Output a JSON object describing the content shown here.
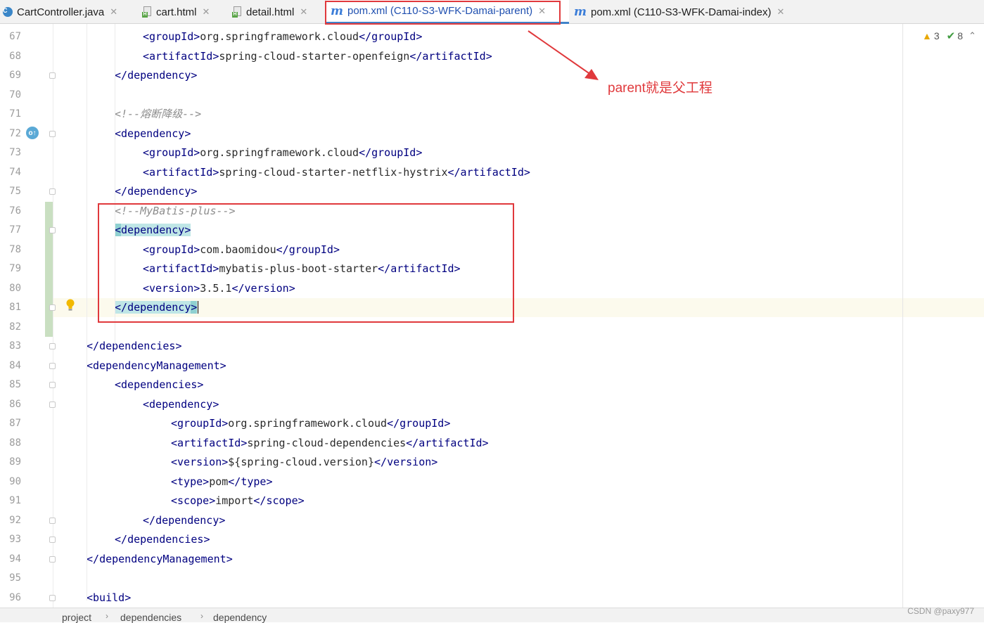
{
  "tabs": [
    {
      "label": "CartController.java",
      "icon": "java-class-icon",
      "active": false
    },
    {
      "label": "cart.html",
      "icon": "html-file-icon",
      "active": false
    },
    {
      "label": "detail.html",
      "icon": "html-file-icon",
      "active": false
    },
    {
      "label": "pom.xml (C110-S3-WFK-Damai-parent)",
      "icon": "maven-icon",
      "active": true
    },
    {
      "label": "pom.xml (C110-S3-WFK-Damai-index)",
      "icon": "maven-icon",
      "active": false
    }
  ],
  "editor": {
    "lines": [
      {
        "num": "67",
        "indent": 3,
        "tokens": [
          [
            "b",
            "<"
          ],
          [
            "b",
            "groupId"
          ],
          [
            "b",
            ">"
          ],
          [
            "k",
            "org.springframework.cloud"
          ],
          [
            "b",
            "</"
          ],
          [
            "b",
            "groupId"
          ],
          [
            "b",
            ">"
          ]
        ]
      },
      {
        "num": "68",
        "indent": 3,
        "tokens": [
          [
            "b",
            "<"
          ],
          [
            "b",
            "artifactId"
          ],
          [
            "b",
            ">"
          ],
          [
            "k",
            "spring-cloud-starter-openfeign"
          ],
          [
            "b",
            "</"
          ],
          [
            "b",
            "artifactId"
          ],
          [
            "b",
            ">"
          ]
        ]
      },
      {
        "num": "69",
        "indent": 2,
        "tokens": [
          [
            "b",
            "</"
          ],
          [
            "b",
            "dependency"
          ],
          [
            "b",
            ">"
          ]
        ]
      },
      {
        "num": "70",
        "indent": 0,
        "tokens": []
      },
      {
        "num": "71",
        "indent": 2,
        "tokens": [
          [
            "cm",
            "<!--熔断降级-->"
          ]
        ]
      },
      {
        "num": "72",
        "indent": 2,
        "tokens": [
          [
            "b",
            "<"
          ],
          [
            "b",
            "dependency"
          ],
          [
            "b",
            ">"
          ]
        ]
      },
      {
        "num": "73",
        "indent": 3,
        "tokens": [
          [
            "b",
            "<"
          ],
          [
            "b",
            "groupId"
          ],
          [
            "b",
            ">"
          ],
          [
            "k",
            "org.springframework.cloud"
          ],
          [
            "b",
            "</"
          ],
          [
            "b",
            "groupId"
          ],
          [
            "b",
            ">"
          ]
        ]
      },
      {
        "num": "74",
        "indent": 3,
        "tokens": [
          [
            "b",
            "<"
          ],
          [
            "b",
            "artifactId"
          ],
          [
            "b",
            ">"
          ],
          [
            "k",
            "spring-cloud-starter-netflix-hystrix"
          ],
          [
            "b",
            "</"
          ],
          [
            "b",
            "artifactId"
          ],
          [
            "b",
            ">"
          ]
        ]
      },
      {
        "num": "75",
        "indent": 2,
        "tokens": [
          [
            "b",
            "</"
          ],
          [
            "b",
            "dependency"
          ],
          [
            "b",
            ">"
          ]
        ]
      },
      {
        "num": "76",
        "indent": 2,
        "tokens": [
          [
            "cm",
            "<!--MyBatis-plus-->"
          ]
        ]
      },
      {
        "num": "77",
        "indent": 2,
        "tokens": [
          [
            "hb",
            "<"
          ],
          [
            "hl",
            "dependency"
          ],
          [
            "hl",
            ">"
          ]
        ]
      },
      {
        "num": "78",
        "indent": 3,
        "tokens": [
          [
            "b",
            "<"
          ],
          [
            "b",
            "groupId"
          ],
          [
            "b",
            ">"
          ],
          [
            "k",
            "com.baomidou"
          ],
          [
            "b",
            "</"
          ],
          [
            "b",
            "groupId"
          ],
          [
            "b",
            ">"
          ]
        ]
      },
      {
        "num": "79",
        "indent": 3,
        "tokens": [
          [
            "b",
            "<"
          ],
          [
            "b",
            "artifactId"
          ],
          [
            "b",
            ">"
          ],
          [
            "k",
            "mybatis-plus-boot-starter"
          ],
          [
            "b",
            "</"
          ],
          [
            "b",
            "artifactId"
          ],
          [
            "b",
            ">"
          ]
        ]
      },
      {
        "num": "80",
        "indent": 3,
        "tokens": [
          [
            "b",
            "<"
          ],
          [
            "b",
            "version"
          ],
          [
            "b",
            ">"
          ],
          [
            "k",
            "3.5.1"
          ],
          [
            "b",
            "</"
          ],
          [
            "b",
            "version"
          ],
          [
            "b",
            ">"
          ]
        ]
      },
      {
        "num": "81",
        "indent": 2,
        "tokens": [
          [
            "hl",
            "</"
          ],
          [
            "hl",
            "dependency"
          ],
          [
            "hb",
            ">"
          ]
        ]
      },
      {
        "num": "82",
        "indent": 0,
        "tokens": []
      },
      {
        "num": "83",
        "indent": 1,
        "tokens": [
          [
            "b",
            "</"
          ],
          [
            "b",
            "dependencies"
          ],
          [
            "b",
            ">"
          ]
        ]
      },
      {
        "num": "84",
        "indent": 1,
        "tokens": [
          [
            "b",
            "<"
          ],
          [
            "b",
            "dependencyManagement"
          ],
          [
            "b",
            ">"
          ]
        ]
      },
      {
        "num": "85",
        "indent": 2,
        "tokens": [
          [
            "b",
            "<"
          ],
          [
            "b",
            "dependencies"
          ],
          [
            "b",
            ">"
          ]
        ]
      },
      {
        "num": "86",
        "indent": 3,
        "tokens": [
          [
            "b",
            "<"
          ],
          [
            "b",
            "dependency"
          ],
          [
            "b",
            ">"
          ]
        ]
      },
      {
        "num": "87",
        "indent": 4,
        "tokens": [
          [
            "b",
            "<"
          ],
          [
            "b",
            "groupId"
          ],
          [
            "b",
            ">"
          ],
          [
            "k",
            "org.springframework.cloud"
          ],
          [
            "b",
            "</"
          ],
          [
            "b",
            "groupId"
          ],
          [
            "b",
            ">"
          ]
        ]
      },
      {
        "num": "88",
        "indent": 4,
        "tokens": [
          [
            "b",
            "<"
          ],
          [
            "b",
            "artifactId"
          ],
          [
            "b",
            ">"
          ],
          [
            "k",
            "spring-cloud-dependencies"
          ],
          [
            "b",
            "</"
          ],
          [
            "b",
            "artifactId"
          ],
          [
            "b",
            ">"
          ]
        ]
      },
      {
        "num": "89",
        "indent": 4,
        "tokens": [
          [
            "b",
            "<"
          ],
          [
            "b",
            "version"
          ],
          [
            "b",
            ">"
          ],
          [
            "k",
            "${spring-cloud.version}"
          ],
          [
            "b",
            "</"
          ],
          [
            "b",
            "version"
          ],
          [
            "b",
            ">"
          ]
        ]
      },
      {
        "num": "90",
        "indent": 4,
        "tokens": [
          [
            "b",
            "<"
          ],
          [
            "b",
            "type"
          ],
          [
            "b",
            ">"
          ],
          [
            "k",
            "pom"
          ],
          [
            "b",
            "</"
          ],
          [
            "b",
            "type"
          ],
          [
            "b",
            ">"
          ]
        ]
      },
      {
        "num": "91",
        "indent": 4,
        "tokens": [
          [
            "b",
            "<"
          ],
          [
            "b",
            "scope"
          ],
          [
            "b",
            ">"
          ],
          [
            "k",
            "import"
          ],
          [
            "b",
            "</"
          ],
          [
            "b",
            "scope"
          ],
          [
            "b",
            ">"
          ]
        ]
      },
      {
        "num": "92",
        "indent": 3,
        "tokens": [
          [
            "b",
            "</"
          ],
          [
            "b",
            "dependency"
          ],
          [
            "b",
            ">"
          ]
        ]
      },
      {
        "num": "93",
        "indent": 2,
        "tokens": [
          [
            "b",
            "</"
          ],
          [
            "b",
            "dependencies"
          ],
          [
            "b",
            ">"
          ]
        ]
      },
      {
        "num": "94",
        "indent": 1,
        "tokens": [
          [
            "b",
            "</"
          ],
          [
            "b",
            "dependencyManagement"
          ],
          [
            "b",
            ">"
          ]
        ]
      },
      {
        "num": "95",
        "indent": 0,
        "tokens": []
      },
      {
        "num": "96",
        "indent": 1,
        "tokens": [
          [
            "b",
            "<"
          ],
          [
            "b",
            "build"
          ],
          [
            "b",
            ">"
          ]
        ]
      }
    ]
  },
  "inspection": {
    "warnings": "3",
    "ok": "8"
  },
  "annotation": {
    "note": "parent就是父工程"
  },
  "breadcrumb": [
    "project",
    "dependencies",
    "dependency"
  ],
  "watermark": "CSDN @paxy977",
  "colors": {
    "tag": "#000080",
    "comment": "#8c8c8c",
    "annotation": "#e0393c",
    "tab_active": "#4083c9"
  }
}
